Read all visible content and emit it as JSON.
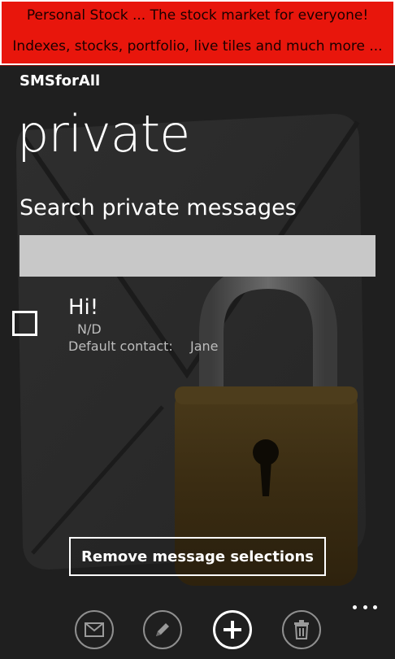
{
  "ad": {
    "line1": "Personal Stock ... The stock market for everyone!",
    "line2": "Indexes, stocks, portfolio, live tiles and much more ..."
  },
  "app": {
    "title": "SMSforAll",
    "page_title": "private"
  },
  "search": {
    "label": "Search private messages",
    "value": "",
    "placeholder": ""
  },
  "messages": [
    {
      "title": "Hi!",
      "date": "N/D",
      "contact_label": "Default contact:",
      "contact_name": "Jane",
      "checked": false
    }
  ],
  "actions": {
    "remove_selections": "Remove message selections"
  },
  "appbar": {
    "buttons": [
      {
        "icon": "envelope-icon"
      },
      {
        "icon": "pencil-icon"
      },
      {
        "icon": "add-icon"
      },
      {
        "icon": "trash-icon"
      }
    ],
    "more": "ellipsis-icon"
  },
  "colors": {
    "ad_background": "#e8160c",
    "background": "#1f1f1f",
    "search_box": "#c8c8c8",
    "secondary_text": "#bdbdbd"
  }
}
